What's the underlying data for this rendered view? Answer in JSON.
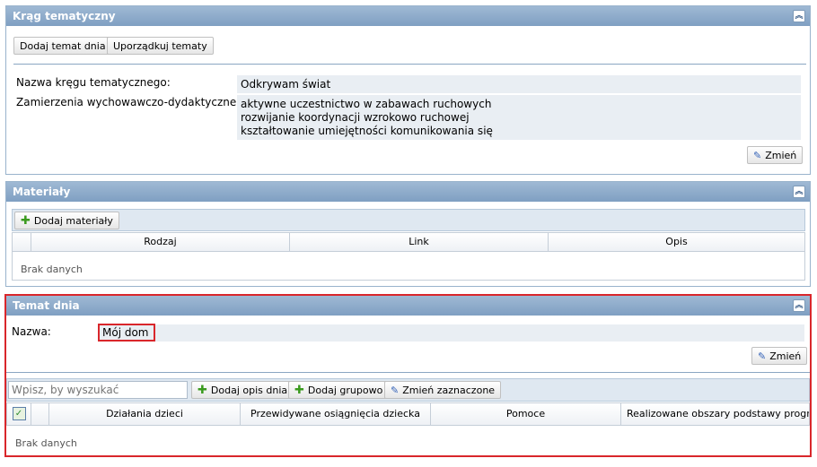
{
  "krag": {
    "title": "Krąg tematyczny",
    "add_topic_btn": "Dodaj temat dnia",
    "sort_topics_btn": "Uporządkuj tematy",
    "name_label": "Nazwa kręgu tematycznego:",
    "name_value": "Odkrywam świat",
    "goals_label": "Zamierzenia wychowawczo-dydaktyczne:",
    "goals": [
      "aktywne uczestnictwo w zabawach ruchowych",
      "rozwijanie koordynacji wzrokowo ruchowej",
      "kształtowanie umiejętności komunikowania się"
    ],
    "change_btn": "Zmień"
  },
  "materialy": {
    "title": "Materiały",
    "add_btn": "Dodaj materiały",
    "columns": [
      "Rodzaj",
      "Link",
      "Opis"
    ],
    "empty": "Brak danych"
  },
  "temat": {
    "title": "Temat dnia",
    "name_label": "Nazwa:",
    "name_value": "Mój dom",
    "change_btn": "Zmień",
    "search_placeholder": "Wpisz, by wyszukać",
    "add_desc_btn": "Dodaj opis dnia",
    "add_group_btn": "Dodaj grupowo",
    "change_selected_btn": "Zmień zaznaczone",
    "columns": [
      "Działania dzieci",
      "Przewidywane osiągnięcia dziecka",
      "Pomoce",
      "Realizowane obszary podstawy progra..."
    ],
    "empty": "Brak danych"
  },
  "colors": {
    "header_bg": "#8eaacb",
    "highlight_border": "#d9262b",
    "value_bg": "#e9eef3"
  }
}
